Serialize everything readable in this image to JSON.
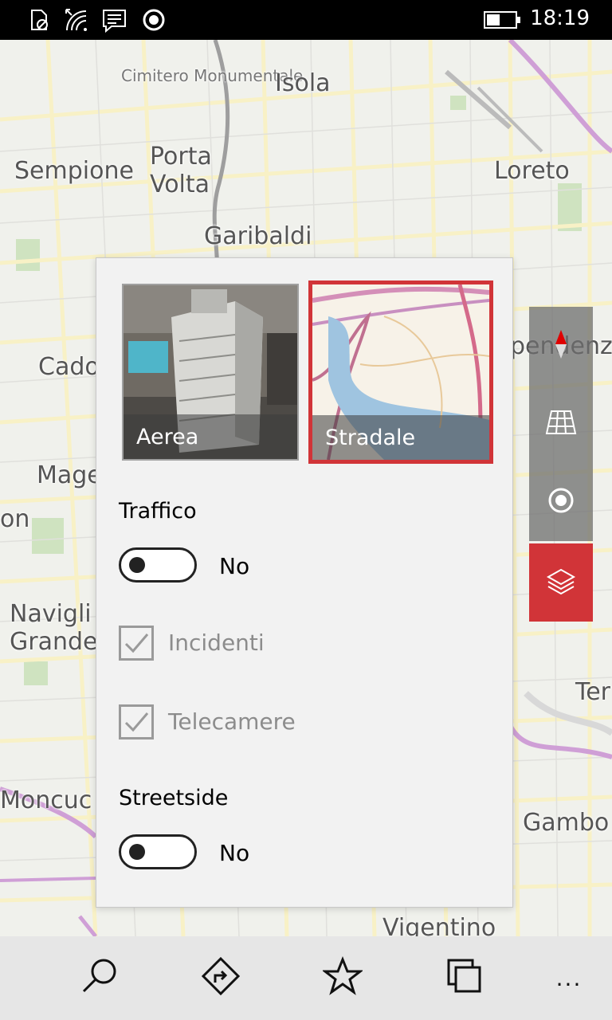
{
  "status_bar": {
    "icons": [
      "no-sim-icon",
      "wifi-icon",
      "message-icon",
      "record-icon",
      "battery-icon"
    ],
    "time": "18:19"
  },
  "map": {
    "labels": [
      "Cimitero Monumentale",
      "Isola",
      "Sempione",
      "Porta Volta",
      "Loreto",
      "Garibaldi",
      "Cado",
      "Mage",
      "on",
      "Navigli Grande",
      "Moncuc",
      "Vigentino",
      "Gambo",
      "Ter",
      "pendenz"
    ]
  },
  "map_controls": {
    "items": [
      "compass-icon",
      "3d-grid-icon",
      "locate-icon",
      "layers-icon"
    ],
    "active_color": "#d13438"
  },
  "layers_panel": {
    "aerial_label": "Aerea",
    "road_label": "Stradale",
    "traffic_title": "Traffico",
    "traffic_state": "No",
    "incidents_label": "Incidenti",
    "cameras_label": "Telecamere",
    "streetside_title": "Streetside",
    "streetside_state": "No"
  },
  "app_bar": {
    "items": [
      "search-icon",
      "directions-icon",
      "favorites-icon",
      "collections-icon",
      "more-icon"
    ],
    "more": "..."
  }
}
